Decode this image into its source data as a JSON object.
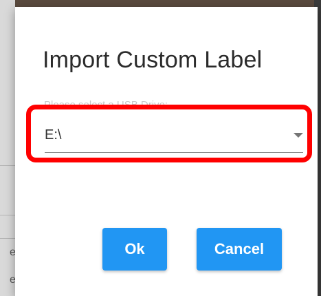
{
  "dialog": {
    "title": "Import Custom Label",
    "usb_select": {
      "label": "Please select a USB Drive:",
      "value": "E:\\"
    },
    "buttons": {
      "ok_label": "Ok",
      "cancel_label": "Cancel"
    }
  },
  "backdrop": {
    "glyph_1": "e",
    "glyph_2": "e"
  },
  "colors": {
    "button_primary": "#2196f3",
    "highlight": "#ff0000",
    "title_text": "#2b2b2b"
  }
}
